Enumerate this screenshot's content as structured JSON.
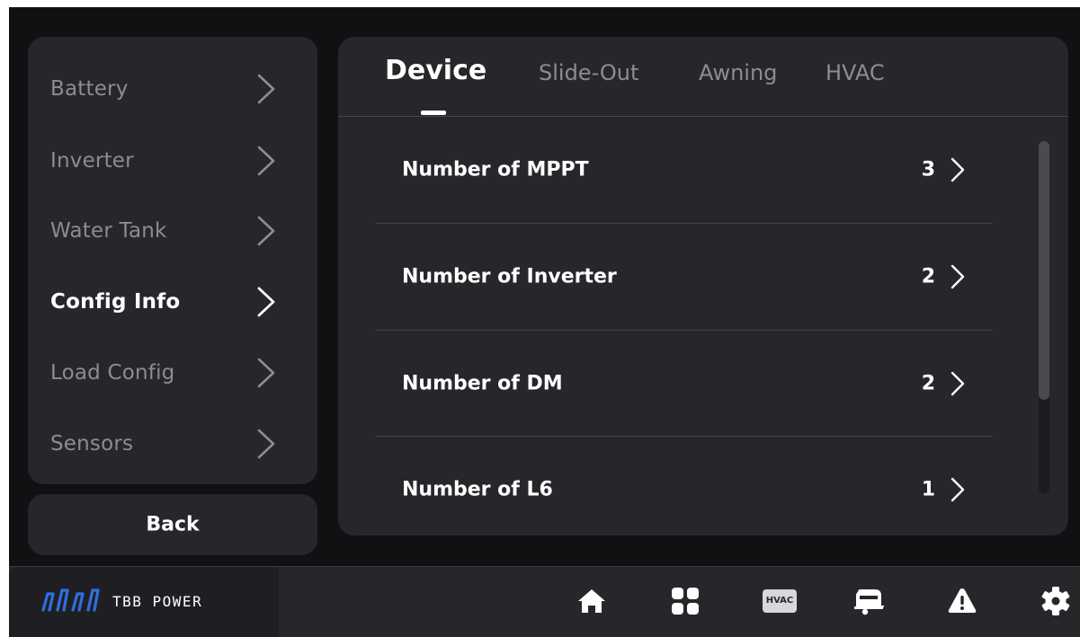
{
  "sidebar": {
    "items": [
      {
        "label": "Battery",
        "active": false
      },
      {
        "label": "Inverter",
        "active": false
      },
      {
        "label": "Water Tank",
        "active": false
      },
      {
        "label": "Config Info",
        "active": true
      },
      {
        "label": "Load Config",
        "active": false
      },
      {
        "label": "Sensors",
        "active": false
      }
    ],
    "back_label": "Back"
  },
  "tabs": [
    {
      "label": "Device",
      "active": true
    },
    {
      "label": "Slide-Out",
      "active": false
    },
    {
      "label": "Awning",
      "active": false
    },
    {
      "label": "HVAC",
      "active": false
    }
  ],
  "rows": [
    {
      "label": "Number of MPPT",
      "value": "3"
    },
    {
      "label": "Number of Inverter",
      "value": "2"
    },
    {
      "label": "Number of DM",
      "value": "2"
    },
    {
      "label": "Number of L6",
      "value": "1"
    }
  ],
  "bottom_bar": {
    "brand_name": "TBB POWER",
    "hvac_label": "HVAC",
    "icons": [
      "home-icon",
      "grid-icon",
      "hvac-icon",
      "camper-icon",
      "warning-icon",
      "settings-gear-icon"
    ]
  },
  "colors": {
    "background": "#111113",
    "panel": "#27272b",
    "accent_blue": "#2f6fe0",
    "text_active": "#ffffff",
    "text_inactive": "#8c8c91"
  }
}
